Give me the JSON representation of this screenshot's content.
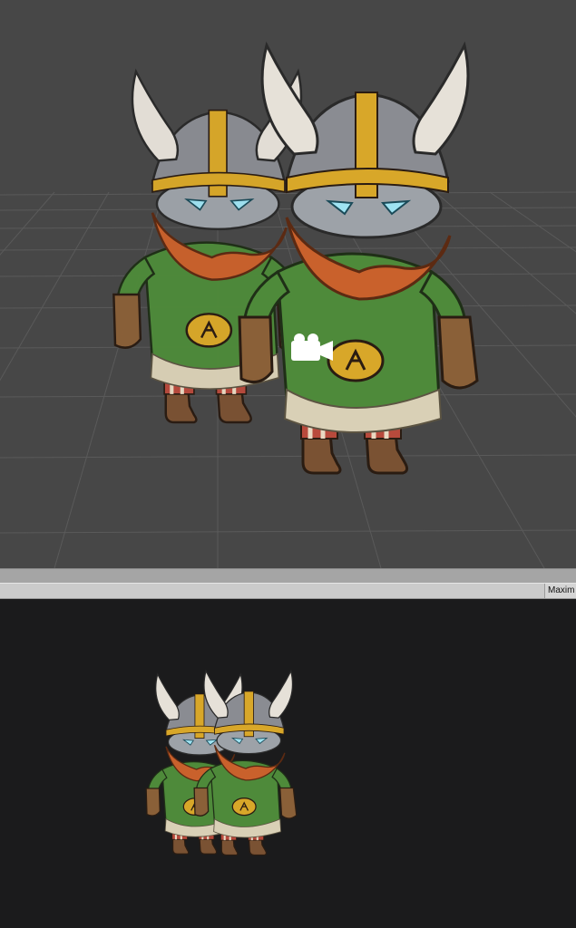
{
  "game_toolbar": {
    "maximize_label": "Maxim"
  },
  "icons": {
    "scene_camera": "camera-icon"
  },
  "colors": {
    "scene_background": "#474747",
    "grid_line": "#5b5b5b",
    "splitter": "#a5a5a5",
    "toolbar": "#cbcbcb",
    "game_background": "#1b1b1c"
  }
}
